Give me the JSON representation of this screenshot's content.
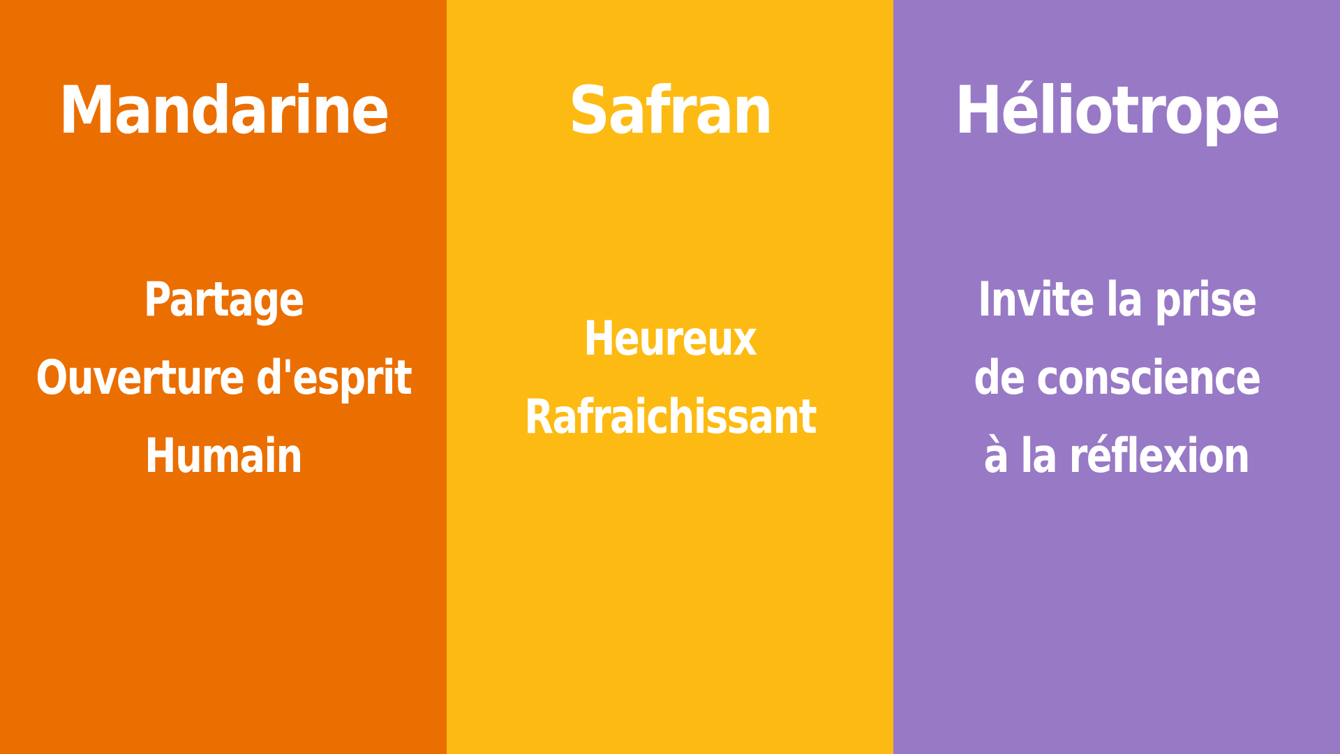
{
  "panels": [
    {
      "title": "Mandarine",
      "color": "#EB6E00",
      "lines": [
        "Partage",
        "Ouverture d'esprit",
        "Humain"
      ]
    },
    {
      "title": "Safran",
      "color": "#FDBA12",
      "lines": [
        "Heureux",
        "Rafraichissant"
      ]
    },
    {
      "title": "Héliotrope",
      "color": "#9879C6",
      "lines": [
        "Invite la prise",
        "de conscience",
        "à la réflexion"
      ]
    }
  ]
}
